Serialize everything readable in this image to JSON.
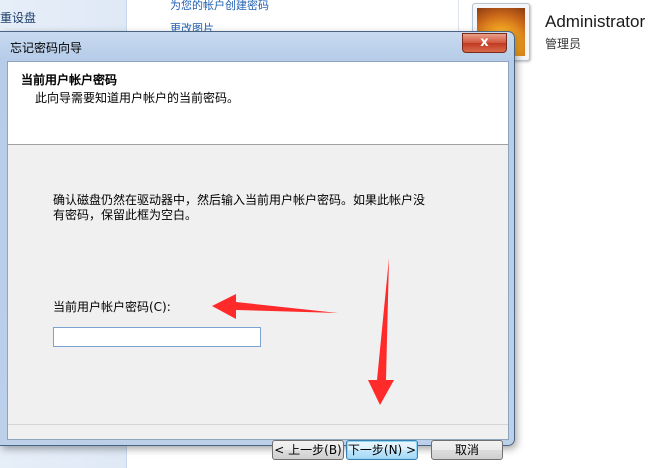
{
  "background": {
    "left_link": "重设盘",
    "links": [
      "为您的帐户创建密码",
      "更改图片"
    ],
    "account": {
      "name": "Administrator",
      "role": "管理员"
    }
  },
  "dialog": {
    "title": "忘记密码向导",
    "close_label": "x",
    "header_title": "当前用户帐户密码",
    "header_subtitle": "此向导需要知道用户帐户的当前密码。",
    "instructions": "确认磁盘仍然在驱动器中，然后输入当前用户帐户密码。如果此帐户没有密码，保留此框为空白。",
    "password_label": "当前用户帐户密码(C):",
    "password_value": "",
    "buttons": {
      "back": "< 上一步(B)",
      "next": "下一步(N) >",
      "cancel": "取消"
    }
  },
  "annotation_color": "#ff2a2a"
}
